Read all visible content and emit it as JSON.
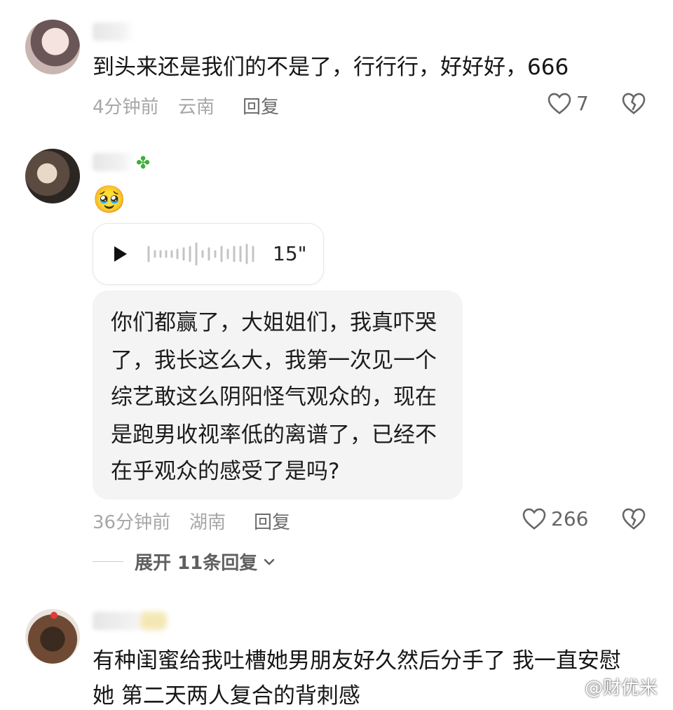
{
  "comments": [
    {
      "text": "到头来还是我们的不是了，行行行，好好好，666",
      "time": "4分钟前",
      "location": "云南",
      "reply_label": "回复",
      "likes": "7"
    },
    {
      "emoji": "🥹",
      "voice_duration": "15\"",
      "quote_lines": [
        "你们都赢了，大姐姐们，我真吓哭",
        "了，我长这么大，我第一次见一个",
        "综艺敢这么阴阳怪气观众的，现在",
        "是跑男收视率低的离谱了，已经不",
        "在乎观众的感受了是吗?"
      ],
      "time": "36分钟前",
      "location": "湖南",
      "reply_label": "回复",
      "likes": "266",
      "expand_label": "展开 11条回复"
    },
    {
      "text_lines": [
        "有种闺蜜给我吐槽她男朋友好久然后分手了 我一直安慰",
        "她  第二天两人复合的背刺感"
      ]
    }
  ],
  "watermark": "@财优米",
  "colors": {
    "meta": "#a7a7a7",
    "reply": "#6b6b6b",
    "bubble_bg": "#f4f4f5"
  }
}
